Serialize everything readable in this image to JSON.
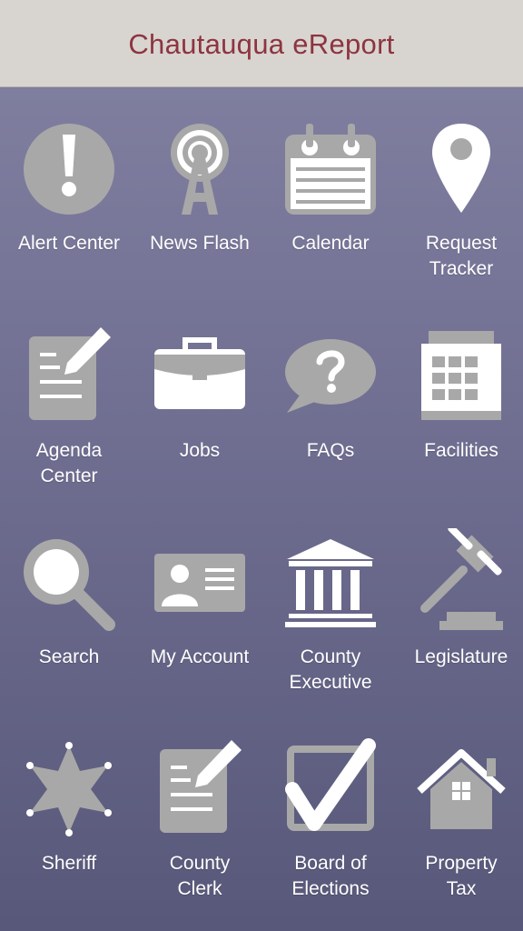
{
  "header": {
    "title": "Chautauqua eReport"
  },
  "tiles": [
    {
      "label": "Alert Center",
      "icon": "alert-icon"
    },
    {
      "label": "News Flash",
      "icon": "broadcast-tower-icon"
    },
    {
      "label": "Calendar",
      "icon": "calendar-icon"
    },
    {
      "label": "Request\nTracker",
      "icon": "map-pin-icon"
    },
    {
      "label": "Agenda\nCenter",
      "icon": "agenda-document-pencil-icon"
    },
    {
      "label": "Jobs",
      "icon": "briefcase-icon"
    },
    {
      "label": "FAQs",
      "icon": "question-bubble-icon"
    },
    {
      "label": "Facilities",
      "icon": "building-icon"
    },
    {
      "label": "Search",
      "icon": "magnifier-icon"
    },
    {
      "label": "My Account",
      "icon": "id-card-icon"
    },
    {
      "label": "County\nExecutive",
      "icon": "government-building-icon"
    },
    {
      "label": "Legislature",
      "icon": "gavel-icon"
    },
    {
      "label": "Sheriff",
      "icon": "sheriff-star-icon"
    },
    {
      "label": "County\nClerk",
      "icon": "clerk-document-pencil-icon"
    },
    {
      "label": "Board of\nElections",
      "icon": "checkbox-checkmark-icon"
    },
    {
      "label": "Property\nTax",
      "icon": "house-icon"
    }
  ],
  "colors": {
    "header_background": "#d8d5d0",
    "title_text": "#8e3440",
    "icon_fill": "#a8a8a8",
    "icon_detail": "#ffffff",
    "label_text": "#ffffff"
  }
}
